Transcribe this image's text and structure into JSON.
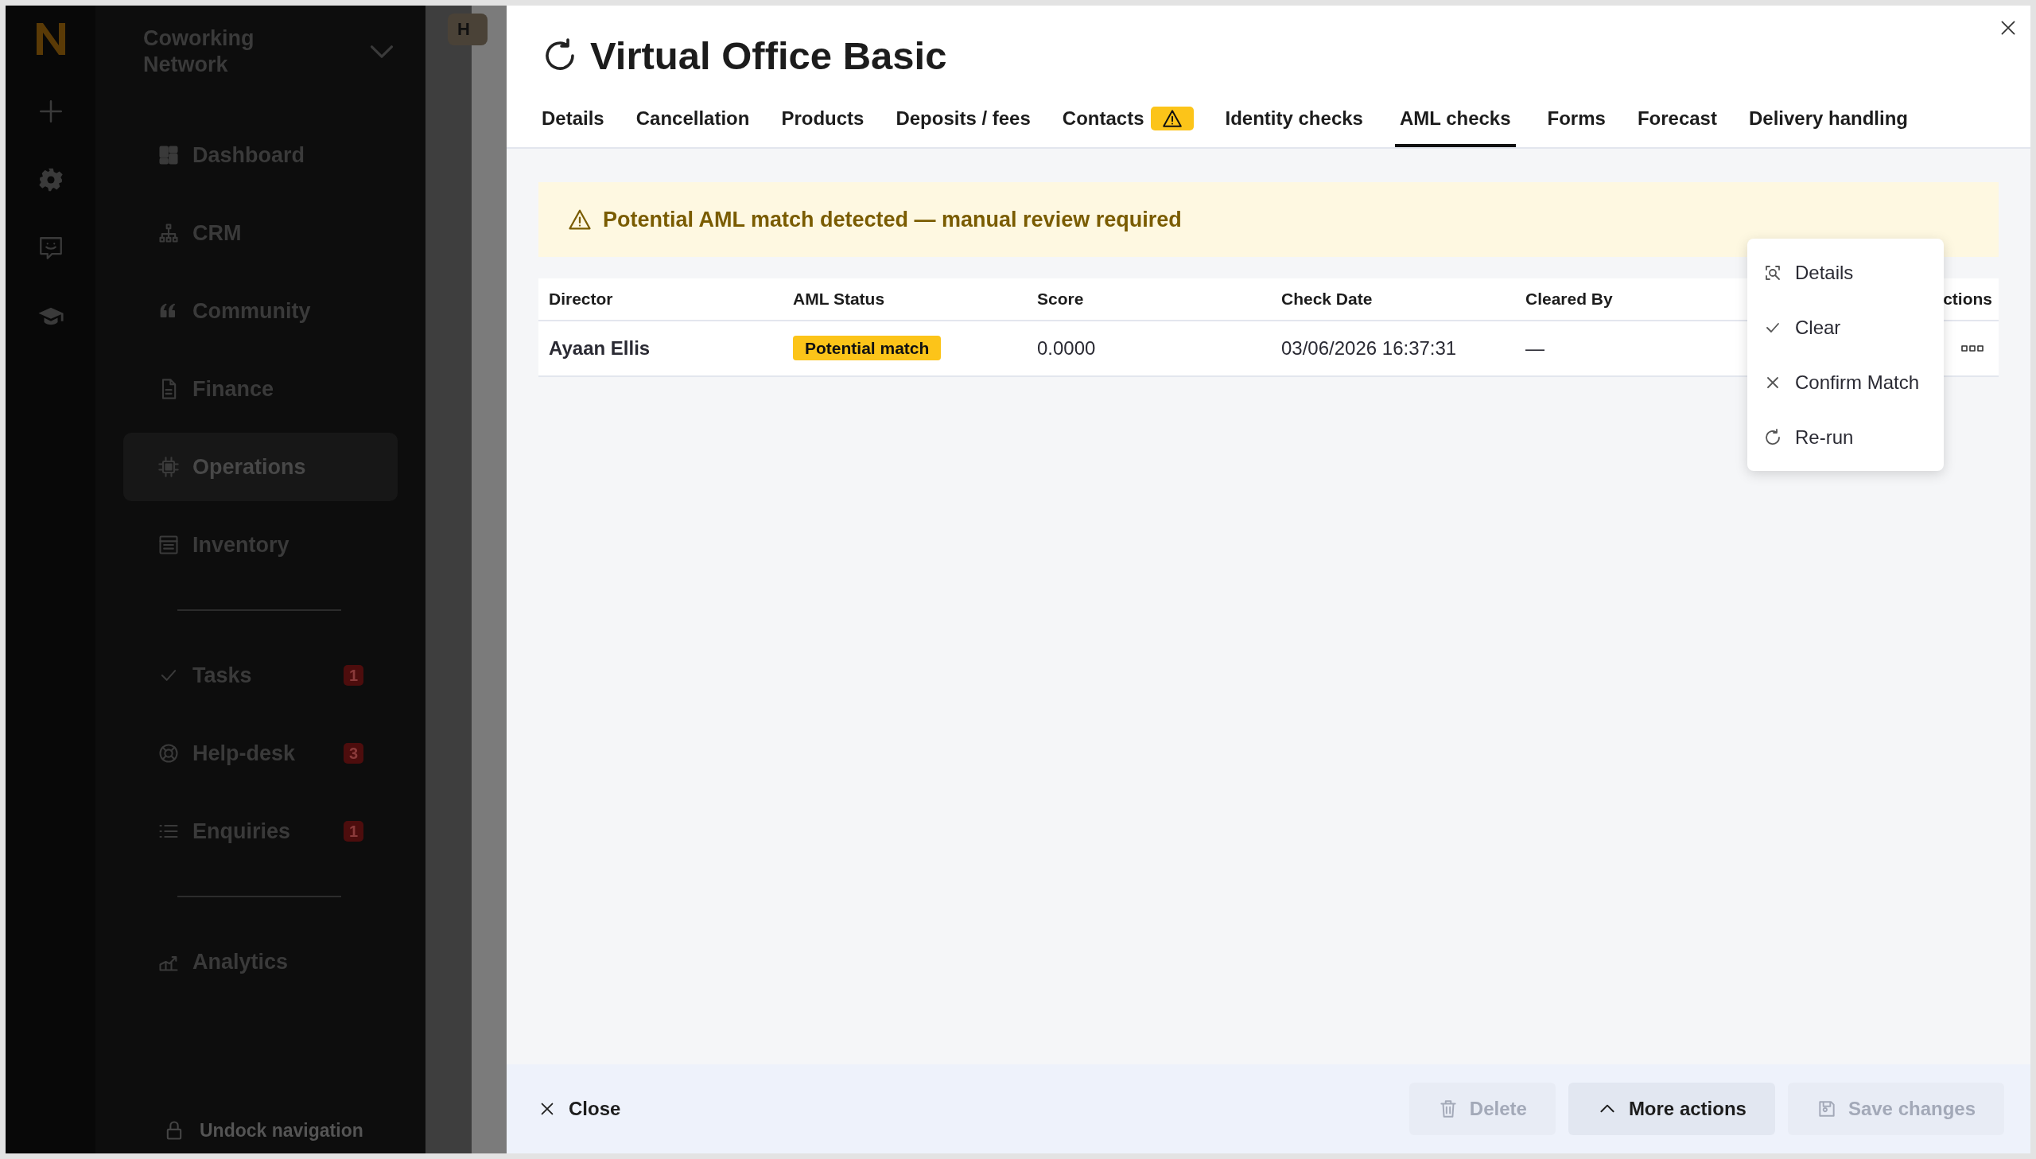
{
  "sidebar": {
    "org_name": "Coworking Network",
    "nav_groups": [
      [
        {
          "label": "Dashboard",
          "selected": false
        },
        {
          "label": "CRM",
          "selected": false
        },
        {
          "label": "Community",
          "selected": false
        },
        {
          "label": "Finance",
          "selected": false
        },
        {
          "label": "Operations",
          "selected": true
        },
        {
          "label": "Inventory",
          "selected": false
        }
      ],
      [
        {
          "label": "Tasks",
          "selected": false,
          "badge": "1"
        },
        {
          "label": "Help-desk",
          "selected": false,
          "badge": "3"
        },
        {
          "label": "Enquiries",
          "selected": false,
          "badge": "1"
        }
      ],
      [
        {
          "label": "Analytics",
          "selected": false
        }
      ]
    ],
    "undock": "Undock navigation"
  },
  "background_tab": "H",
  "panel": {
    "title": "Virtual Office Basic",
    "tabs": [
      {
        "label": "Details",
        "selected": false,
        "warning": false
      },
      {
        "label": "Cancellation",
        "selected": false,
        "warning": false
      },
      {
        "label": "Products",
        "selected": false,
        "warning": false
      },
      {
        "label": "Deposits / fees",
        "selected": false,
        "warning": false
      },
      {
        "label": "Contacts",
        "selected": false,
        "warning": true
      },
      {
        "label": "Identity checks",
        "selected": false,
        "warning": false
      },
      {
        "label": "AML checks",
        "selected": true,
        "warning": false
      },
      {
        "label": "Forms",
        "selected": false,
        "warning": false
      },
      {
        "label": "Forecast",
        "selected": false,
        "warning": false
      },
      {
        "label": "Delivery handling",
        "selected": false,
        "warning": false
      }
    ],
    "alert": "Potential AML match detected — manual review required",
    "table": {
      "columns": [
        "Director",
        "AML Status",
        "Score",
        "Check Date",
        "Cleared By",
        "ctions"
      ],
      "rows": [
        {
          "director": "Ayaan Ellis",
          "aml_status": "Potential match",
          "score": "0.0000",
          "check_date": "03/06/2026 16:37:31",
          "cleared_by": "—"
        }
      ]
    },
    "menu": [
      {
        "label": "Details",
        "kind": "details"
      },
      {
        "label": "Clear",
        "kind": "clear"
      },
      {
        "label": "Confirm Match",
        "kind": "confirm"
      },
      {
        "label": "Re-run",
        "kind": "rerun"
      }
    ],
    "footer": {
      "close": "Close",
      "buttons": [
        {
          "label": "Delete",
          "kind": "delete",
          "disabled": true
        },
        {
          "label": "More actions",
          "kind": "more",
          "disabled": false
        },
        {
          "label": "Save changes",
          "kind": "save",
          "disabled": true
        }
      ]
    }
  }
}
